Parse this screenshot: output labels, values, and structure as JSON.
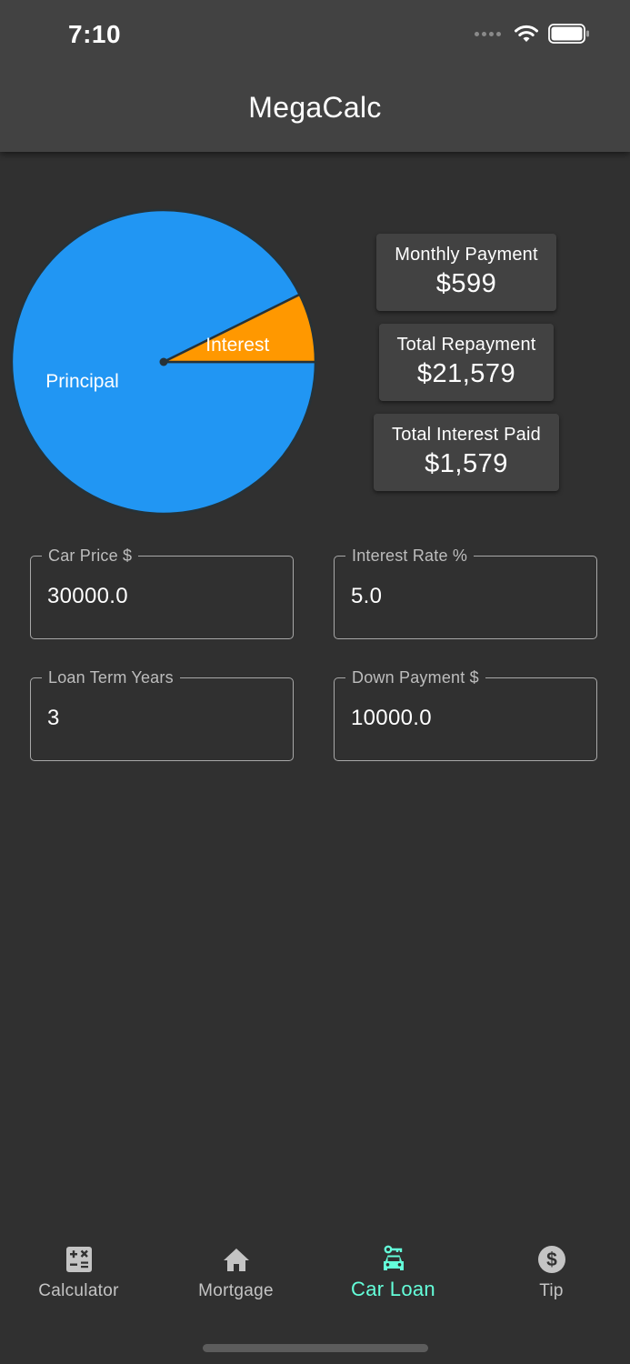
{
  "status_bar": {
    "time": "7:10"
  },
  "app_bar": {
    "title": "MegaCalc"
  },
  "chart_data": {
    "type": "pie",
    "slices": [
      {
        "label": "Principal",
        "value": 20000,
        "color": "#2196f3"
      },
      {
        "label": "Interest",
        "value": 1579,
        "color": "#ff9800"
      }
    ],
    "legend": "none"
  },
  "results": [
    {
      "label": "Monthly Payment",
      "value": "$599"
    },
    {
      "label": "Total Repayment",
      "value": "$21,579"
    },
    {
      "label": "Total Interest Paid",
      "value": "$1,579"
    }
  ],
  "inputs": {
    "car_price": {
      "label": "Car Price $",
      "value": "30000.0"
    },
    "interest_rate": {
      "label": "Interest Rate %",
      "value": "5.0"
    },
    "loan_term": {
      "label": "Loan Term Years",
      "value": "3"
    },
    "down_payment": {
      "label": "Down Payment $",
      "value": "10000.0"
    }
  },
  "bottom_nav": {
    "active_color": "#64ffda",
    "items": [
      {
        "label": "Calculator",
        "icon": "calculator-icon"
      },
      {
        "label": "Mortgage",
        "icon": "home-icon"
      },
      {
        "label": "Car Loan",
        "icon": "car-key-icon"
      },
      {
        "label": "Tip",
        "icon": "dollar-icon"
      }
    ]
  }
}
